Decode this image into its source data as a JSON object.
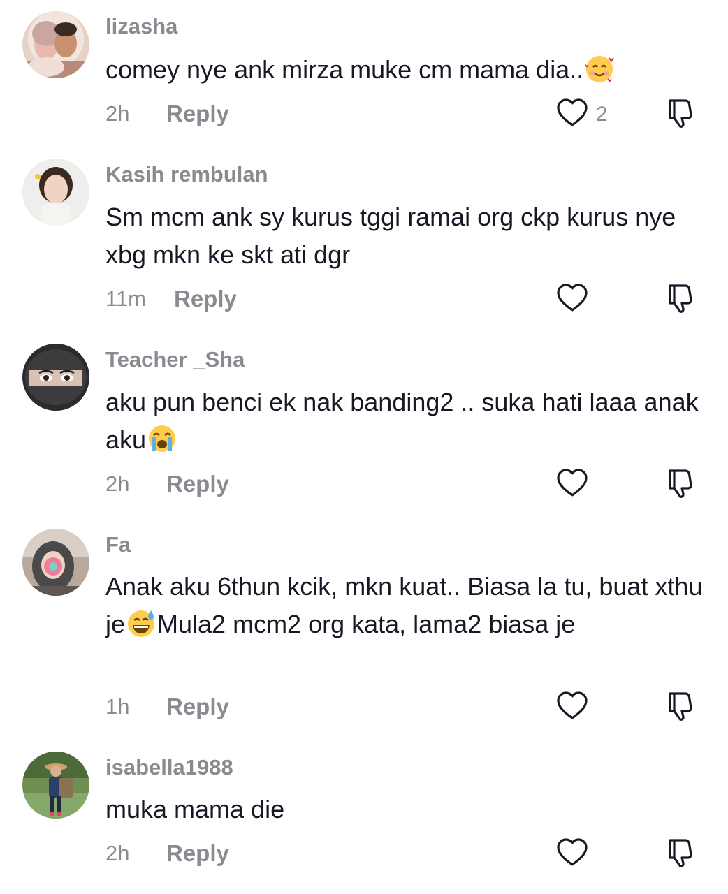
{
  "comments": [
    {
      "username": "lizasha",
      "text_before": "comey nye ank mirza muke cm mama dia..",
      "emoji_1": "smiling-face-with-hearts",
      "text_after": "",
      "time": "2h",
      "reply_label": "Reply",
      "likes": "2"
    },
    {
      "username": "Kasih rembulan",
      "text_before": "Sm mcm ank sy kurus tggi ramai org ckp kurus nye xbg mkn ke skt ati dgr",
      "text_after": "",
      "time": "11m",
      "reply_label": "Reply",
      "likes": ""
    },
    {
      "username": "Teacher _Sha",
      "text_before": "aku pun benci ek nak banding2 .. suka hati laaa anak aku",
      "emoji_1": "loudly-crying-face",
      "text_after": "",
      "time": "2h",
      "reply_label": "Reply",
      "likes": ""
    },
    {
      "username": "Fa",
      "text_before": "Anak aku 6thun kcik, mkn kuat.. Biasa la tu, buat xthu je",
      "emoji_1": "grinning-face-with-sweat",
      "text_after": "Mula2 mcm2 org kata, lama2 biasa je",
      "time": "1h",
      "reply_label": "Reply",
      "likes": ""
    },
    {
      "username": "isabella1988",
      "text_before": "muka mama die",
      "text_after": "",
      "time": "2h",
      "reply_label": "Reply",
      "likes": ""
    }
  ],
  "icons": {
    "like": "heart-outline-icon",
    "dislike": "thumbs-down-outline-icon"
  },
  "colors": {
    "text": "#161823",
    "secondary": "#8a8b91",
    "background": "#ffffff"
  }
}
